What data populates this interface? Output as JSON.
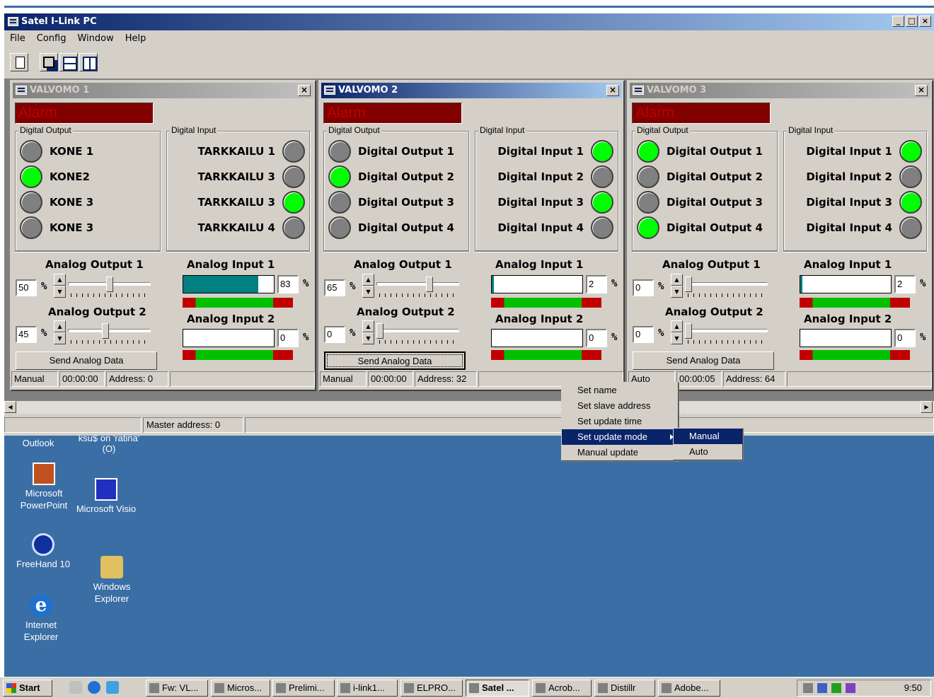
{
  "app": {
    "title": "Satel I-Link PC",
    "win_min": "_",
    "win_max": "□",
    "win_close": "×"
  },
  "menu": [
    "File",
    "Config",
    "Window",
    "Help"
  ],
  "common": {
    "alarm": "Alarm",
    "do_group": "Digital Output",
    "di_group": "Digital Input",
    "send": "Send Analog Data",
    "pct": "%",
    "ao1": "Analog Output 1",
    "ao2": "Analog Output 2",
    "ai1": "Analog Input 1",
    "ai2": "Analog Input 2",
    "close": "×"
  },
  "windows": [
    {
      "title": "VALVOMO 1",
      "active": false,
      "outputs": [
        {
          "label": "KONE 1",
          "on": false
        },
        {
          "label": "KONE2",
          "on": true
        },
        {
          "label": "KONE 3",
          "on": false
        },
        {
          "label": "KONE 3",
          "on": false
        }
      ],
      "inputs": [
        {
          "label": "TARKKAILU 1",
          "on": false
        },
        {
          "label": "TARKKAILU 3",
          "on": false
        },
        {
          "label": "TARKKAILU 3",
          "on": true
        },
        {
          "label": "TARKKAILU 4",
          "on": false
        }
      ],
      "ao1": "50",
      "ao2": "45",
      "ai1": "83",
      "ai2": "0",
      "status": [
        "Manual",
        "00:00:00",
        "Address: 0",
        ""
      ]
    },
    {
      "title": "VALVOMO 2",
      "active": true,
      "outputs": [
        {
          "label": "Digital Output 1",
          "on": false
        },
        {
          "label": "Digital Output 2",
          "on": true
        },
        {
          "label": "Digital Output 3",
          "on": false
        },
        {
          "label": "Digital Output 4",
          "on": false
        }
      ],
      "inputs": [
        {
          "label": "Digital Input 1",
          "on": true
        },
        {
          "label": "Digital Input 2",
          "on": false
        },
        {
          "label": "Digital Input 3",
          "on": true
        },
        {
          "label": "Digital Input 4",
          "on": false
        }
      ],
      "ao1": "65",
      "ao2": "0",
      "ai1": "2",
      "ai2": "0",
      "status": [
        "Manual",
        "00:00:00",
        "Address: 32",
        ""
      ]
    },
    {
      "title": "VALVOMO 3",
      "active": false,
      "outputs": [
        {
          "label": "Digital Output 1",
          "on": true
        },
        {
          "label": "Digital Output 2",
          "on": false
        },
        {
          "label": "Digital Output 3",
          "on": false
        },
        {
          "label": "Digital Output 4",
          "on": true
        }
      ],
      "inputs": [
        {
          "label": "Digital Input 1",
          "on": true
        },
        {
          "label": "Digital Input 2",
          "on": false
        },
        {
          "label": "Digital Input 3",
          "on": true
        },
        {
          "label": "Digital Input 4",
          "on": false
        }
      ],
      "ao1": "0",
      "ao2": "0",
      "ai1": "2",
      "ai2": "0",
      "status": [
        "Auto",
        "00:00:05",
        "Address: 64",
        ""
      ]
    }
  ],
  "appstatus": {
    "left": "",
    "master": "Master address: 0",
    "right": ""
  },
  "context_menu": [
    "Set name",
    "Set slave address",
    "Set update time",
    "Set update mode",
    "Manual update"
  ],
  "submenu": [
    "Manual",
    "Auto"
  ],
  "desktop_icons": [
    "Outlook",
    "ksu$ on 'ratina' (O)",
    "Microsoft PowerPoint",
    "Microsoft Visio",
    "FreeHand 10",
    "Windows Explorer",
    "Internet Explorer"
  ],
  "taskbar": {
    "start": "Start",
    "tasks": [
      "Fw: VL...",
      "Micros...",
      "Prelimi...",
      "i-link1...",
      "ELPRO...",
      "Satel ...",
      "Acrob...",
      "Distillr",
      "Adobe..."
    ],
    "clock": "9:50"
  }
}
